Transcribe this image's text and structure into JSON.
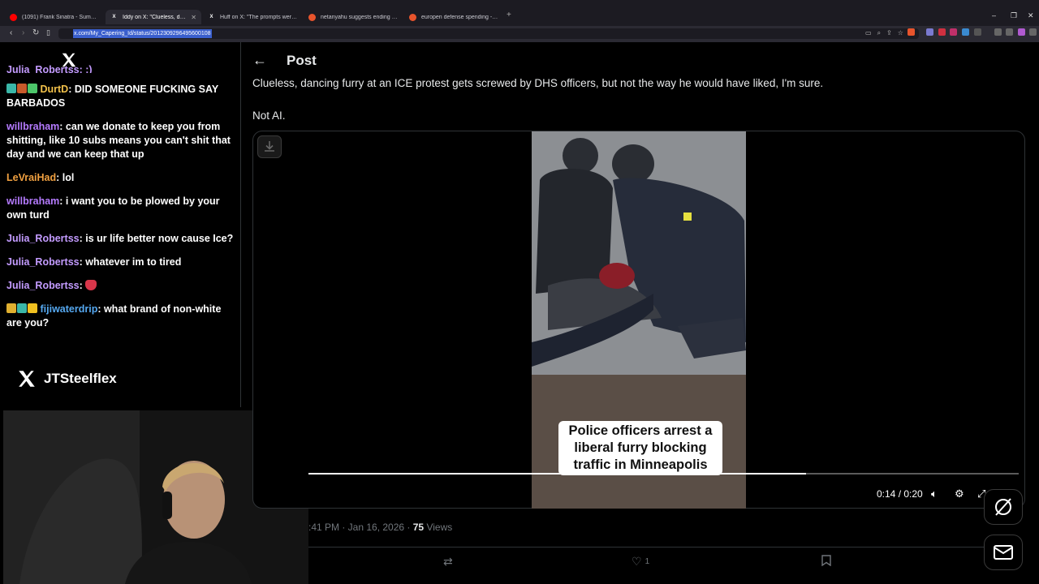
{
  "browser": {
    "tabs": [
      {
        "title": "(1091) Frank Sinatra - Summer Wind",
        "favicon": "youtube-icon",
        "color": "#ff0000",
        "active": false
      },
      {
        "title": "Iddy on X: \"Clueless, dancing fu",
        "favicon": "x-icon",
        "color": "#ffffff",
        "active": true
      },
      {
        "title": "Huff on X: \"The prompts were simple",
        "favicon": "x-icon",
        "color": "#ffffff",
        "active": false
      },
      {
        "title": "netanyahu suggests ending US aid t",
        "favicon": "brave-search-icon",
        "color": "#e8542c",
        "active": false
      },
      {
        "title": "europen defense spending - Brave Se",
        "favicon": "brave-search-icon",
        "color": "#e8542c",
        "active": false
      }
    ],
    "url": "x.com/My_Capering_Id/status/2012309296495600108"
  },
  "overlay": {
    "partial_top_line": "Julia_Robertss: ;)",
    "messages": [
      {
        "user": "DurtD",
        "text": ": DID SOMEONE FUCKING SAY BARBADOS",
        "user_color": "#f2c14a",
        "badges": [
          "#3ab7a8",
          "#c85a2a",
          "#4cc56a"
        ]
      },
      {
        "user": "willbraham",
        "text": ": can we donate to keep you from shitting, like 10 subs means you can't shit that day and we can keep that up",
        "user_color": "#b57bff",
        "badges": []
      },
      {
        "user": "LeVraiHad",
        "text": ": lol",
        "user_color": "#f0a040",
        "badges": []
      },
      {
        "user": "willbraham",
        "text": ": i want you to be plowed by your own turd",
        "user_color": "#b57bff",
        "badges": []
      },
      {
        "user": "Julia_Robertss",
        "text": ": is ur life better now cause Ice?",
        "user_color": "#c39bff",
        "badges": []
      },
      {
        "user": "Julia_Robertss",
        "text": ": whatever im to tired",
        "user_color": "#c39bff",
        "badges": []
      },
      {
        "user": "Julia_Robertss",
        "text": ": ",
        "user_color": "#c39bff",
        "badges": [],
        "emote": "devil-emote-icon"
      },
      {
        "user": "fijiwaterdrip",
        "text": ": what brand of non-white are you?",
        "user_color": "#55a8f0",
        "badges": [
          "#e0b030",
          "#3ab7a8",
          "#f0c020"
        ]
      }
    ],
    "handle": "JTSteelflex"
  },
  "post": {
    "header_title": "Post",
    "text_line1": "Clueless, dancing furry at an ICE protest gets screwed by DHS officers, but not the way he would have liked, I'm sure.",
    "text_line2": "Not AI.",
    "video": {
      "caption": "Police officers arrest a liberal furry blocking traffic in Minneapolis",
      "time": "0:14 / 0:20",
      "progress": 0.7
    },
    "meta": {
      "time_date": ":41 PM · Jan 16, 2026 · ",
      "views_count": "75",
      "views_label": " Views"
    },
    "actions": {
      "likes": "1"
    }
  }
}
